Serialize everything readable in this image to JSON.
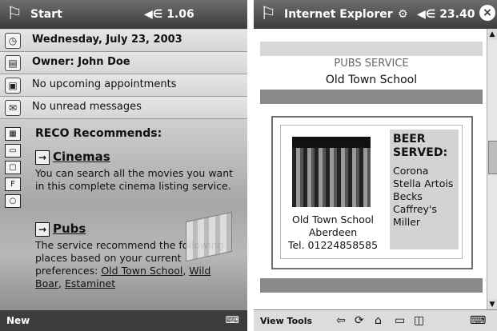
{
  "left_device": {
    "title": "Start",
    "status": "◀∈ 1.06",
    "rows": [
      {
        "icon": "clock-icon",
        "glyph": "◷",
        "text": "Wednesday, July 23, 2003",
        "bold": true
      },
      {
        "icon": "owner-card-icon",
        "glyph": "▤",
        "text": "Owner: John Doe",
        "bold": true
      },
      {
        "icon": "calendar-icon",
        "glyph": "▣",
        "text": "No upcoming appointments",
        "bold": false
      },
      {
        "icon": "envelope-icon",
        "glyph": "✉",
        "text": "No unread messages",
        "bold": false
      }
    ],
    "reco_title": "RECO Recommends:",
    "sections": [
      {
        "label": "Cinemas",
        "desc": "You can search all the movies you want in this complete cinema listing service."
      },
      {
        "label": "Pubs",
        "desc_intro": "The service recommend the following places based on your current preferences:",
        "links": [
          "Old Town School",
          "Wild Boar",
          "Estaminet"
        ]
      }
    ],
    "bottom_left": "New"
  },
  "right_device": {
    "title": "Internet Explorer",
    "status": "◀∈ 23.40",
    "pubs_service": "PUBS SERVICE",
    "pub_name": "Old Town School",
    "address_lines": [
      "Old Town School",
      "Aberdeen",
      "Tel. 01224858585"
    ],
    "beer_title_line1": "BEER",
    "beer_title_line2": "SERVED:",
    "beers": [
      "Corona",
      "Stella Artois",
      "Becks",
      "Caffrey's",
      "Miller"
    ],
    "bottom_label": "View Tools"
  }
}
